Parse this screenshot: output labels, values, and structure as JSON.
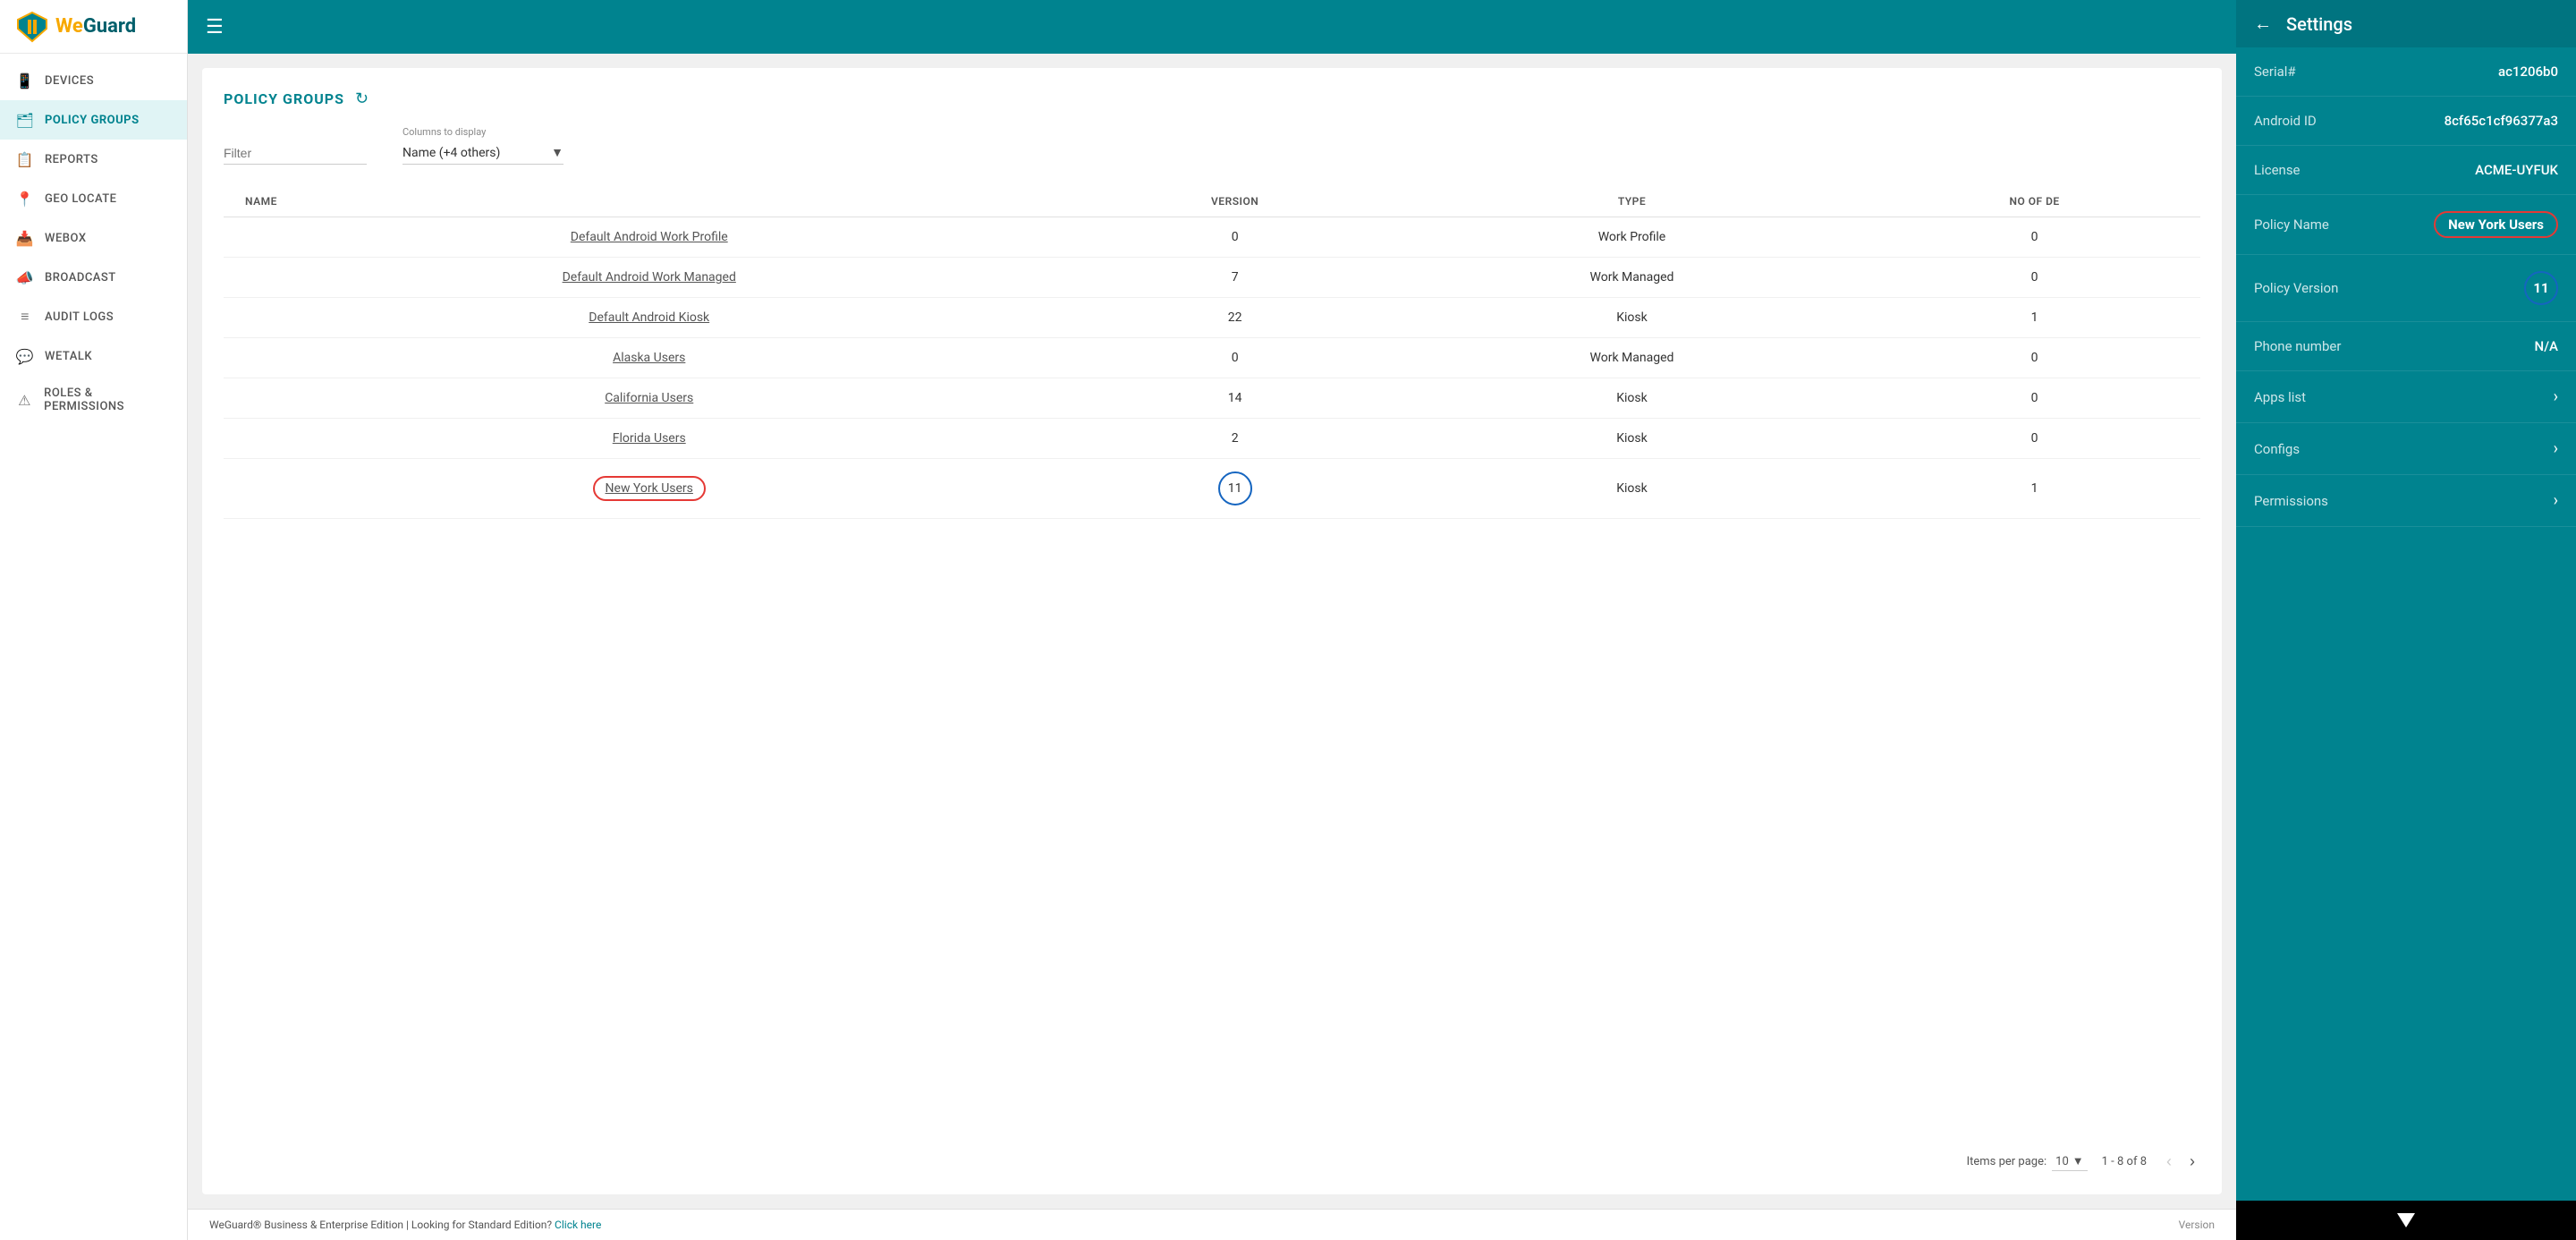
{
  "sidebar": {
    "logo": {
      "we": "We",
      "guard": "Guard"
    },
    "items": [
      {
        "id": "devices",
        "label": "DEVICES",
        "icon": "📱"
      },
      {
        "id": "policy-groups",
        "label": "POLICY GROUPS",
        "icon": "🗂",
        "active": true
      },
      {
        "id": "reports",
        "label": "REPORTS",
        "icon": "📋"
      },
      {
        "id": "geo-locate",
        "label": "GEO LOCATE",
        "icon": "📍"
      },
      {
        "id": "webox",
        "label": "WEBOX",
        "icon": "📥"
      },
      {
        "id": "broadcast",
        "label": "BROADCAST",
        "icon": "📣"
      },
      {
        "id": "audit-logs",
        "label": "AUDIT LOGS",
        "icon": "≡"
      },
      {
        "id": "wetalk",
        "label": "WETALK",
        "icon": "💬"
      },
      {
        "id": "roles-permissions",
        "label": "ROLES & PERMISSIONS",
        "icon": "⚠"
      }
    ]
  },
  "topbar": {
    "hamburger": "☰"
  },
  "panel": {
    "title": "POLICY GROUPS",
    "refresh_icon": "↻",
    "filter_placeholder": "Filter",
    "columns_label": "Columns to display",
    "columns_value": "Name (+4 others)"
  },
  "table": {
    "headers": [
      "NAME",
      "VERSION",
      "TYPE",
      "NO OF DE"
    ],
    "rows": [
      {
        "name": "Default Android Work Profile",
        "version": "0",
        "type": "Work Profile",
        "no_of_de": "0",
        "link": true
      },
      {
        "name": "Default Android Work Managed",
        "version": "7",
        "type": "Work Managed",
        "no_of_de": "0",
        "link": true
      },
      {
        "name": "Default Android Kiosk",
        "version": "22",
        "type": "Kiosk",
        "no_of_de": "1",
        "link": true
      },
      {
        "name": "Alaska Users",
        "version": "0",
        "type": "Work Managed",
        "no_of_de": "0",
        "link": true
      },
      {
        "name": "California Users",
        "version": "14",
        "type": "Kiosk",
        "no_of_de": "0",
        "link": true
      },
      {
        "name": "Florida Users",
        "version": "2",
        "type": "Kiosk",
        "no_of_de": "0",
        "link": true
      },
      {
        "name": "New York Users",
        "version": "11",
        "type": "Kiosk",
        "no_of_de": "1",
        "link": true,
        "highlight_name": true,
        "highlight_version": true
      }
    ]
  },
  "pagination": {
    "items_per_page_label": "Items per page:",
    "items_per_page_value": "10",
    "range": "1 - 8 of 8"
  },
  "footer": {
    "left": "WeGuard® Business & Enterprise Edition | Looking for Standard Edition?",
    "link": "Click here",
    "right": "Version"
  },
  "device_panel": {
    "title": "Settings",
    "back_icon": "←",
    "rows": [
      {
        "label": "Serial#",
        "value": "ac1206b0",
        "type": "text"
      },
      {
        "label": "Android ID",
        "value": "8cf65c1cf96377a3",
        "type": "text"
      },
      {
        "label": "License",
        "value": "ACME-UYFUK",
        "type": "text"
      },
      {
        "label": "Policy Name",
        "value": "New York Users",
        "type": "highlight-red"
      },
      {
        "label": "Policy Version",
        "value": "11",
        "type": "circle-blue"
      },
      {
        "label": "Phone number",
        "value": "N/A",
        "type": "text"
      },
      {
        "label": "Apps list",
        "value": ">",
        "type": "chevron"
      },
      {
        "label": "Configs",
        "value": ">",
        "type": "chevron"
      },
      {
        "label": "Permissions",
        "value": ">",
        "type": "chevron"
      }
    ]
  }
}
